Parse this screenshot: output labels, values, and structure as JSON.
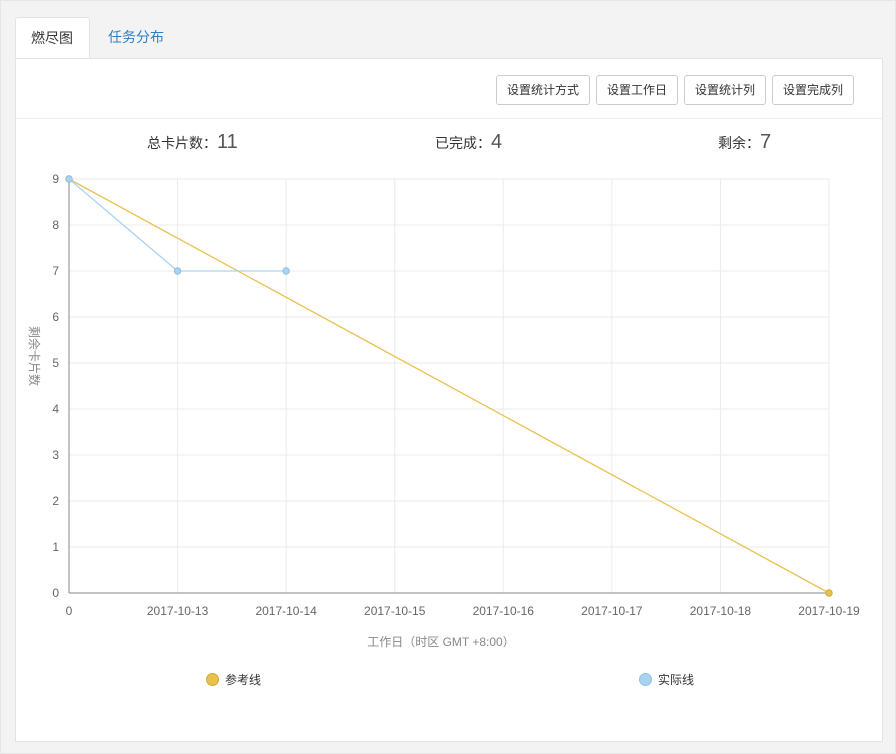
{
  "tabs": [
    {
      "label": "燃尽图",
      "active": true
    },
    {
      "label": "任务分布",
      "active": false
    }
  ],
  "toolbar": {
    "stat_method": "设置统计方式",
    "workdays": "设置工作日",
    "stat_columns": "设置统计列",
    "done_columns": "设置完成列"
  },
  "stats": {
    "total_label": "总卡片数：",
    "total_value": "11",
    "done_label": "已完成：",
    "done_value": "4",
    "remaining_label": "剩余：",
    "remaining_value": "7"
  },
  "chart_data": {
    "type": "line",
    "xlabel": "工作日（时区 GMT +8:00）",
    "ylabel": "剩余卡片数",
    "categories": [
      "0",
      "2017-10-13",
      "2017-10-14",
      "2017-10-15",
      "2017-10-16",
      "2017-10-17",
      "2017-10-18",
      "2017-10-19"
    ],
    "ylim": [
      0,
      9
    ],
    "yticks": [
      0,
      1,
      2,
      3,
      4,
      5,
      6,
      7,
      8,
      9
    ],
    "grid": true,
    "legend_position": "bottom",
    "series": [
      {
        "name": "参考线",
        "color": "#e8c14e",
        "values": [
          9,
          null,
          null,
          null,
          null,
          null,
          null,
          0
        ],
        "markers": [
          true,
          false,
          false,
          false,
          false,
          false,
          false,
          true
        ]
      },
      {
        "name": "实际线",
        "color": "#a9d3ef",
        "values": [
          9,
          7,
          7,
          null,
          null,
          null,
          null,
          null
        ],
        "markers": [
          true,
          true,
          true,
          false,
          false,
          false,
          false,
          false
        ]
      }
    ]
  }
}
